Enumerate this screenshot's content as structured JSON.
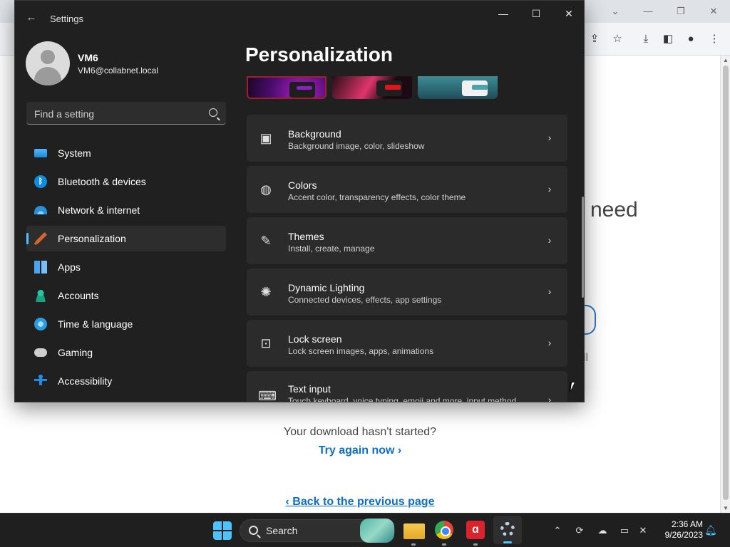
{
  "browser": {
    "content": {
      "heading_fragment": "need",
      "fragment_ll": "ll",
      "download_msg": "Your download hasn't started?",
      "try_again": "Try again now ›",
      "back_link": "‹ Back to the previous page"
    }
  },
  "settings": {
    "window_title": "Settings",
    "user": {
      "name": "VM6",
      "email": "VM6@collabnet.local"
    },
    "search_placeholder": "Find a setting",
    "page_title": "Personalization",
    "nav": [
      {
        "label": "System",
        "icon": "system-icon"
      },
      {
        "label": "Bluetooth & devices",
        "icon": "bluetooth-icon"
      },
      {
        "label": "Network & internet",
        "icon": "wifi-icon"
      },
      {
        "label": "Personalization",
        "icon": "brush-icon",
        "active": true
      },
      {
        "label": "Apps",
        "icon": "apps-icon"
      },
      {
        "label": "Accounts",
        "icon": "person-icon"
      },
      {
        "label": "Time & language",
        "icon": "globe-clock-icon"
      },
      {
        "label": "Gaming",
        "icon": "gamepad-icon"
      },
      {
        "label": "Accessibility",
        "icon": "accessibility-icon"
      }
    ],
    "cards": [
      {
        "title": "Background",
        "subtitle": "Background image, color, slideshow",
        "icon": "image-icon"
      },
      {
        "title": "Colors",
        "subtitle": "Accent color, transparency effects, color theme",
        "icon": "palette-icon"
      },
      {
        "title": "Themes",
        "subtitle": "Install, create, manage",
        "icon": "brush-icon"
      },
      {
        "title": "Dynamic Lighting",
        "subtitle": "Connected devices, effects, app settings",
        "icon": "light-icon"
      },
      {
        "title": "Lock screen",
        "subtitle": "Lock screen images, apps, animations",
        "icon": "lock-screen-icon"
      },
      {
        "title": "Text input",
        "subtitle": "Touch keyboard, voice typing, emoji and more, input method",
        "icon": "keyboard-icon"
      }
    ],
    "theme_thumbs": [
      {
        "name": "dark-purple",
        "accent": "#8e1dc5"
      },
      {
        "name": "dark-red",
        "accent": "#e0141b"
      },
      {
        "name": "teal",
        "accent": "#4aa3ad"
      }
    ]
  },
  "taskbar": {
    "search_label": "Search",
    "time": "2:36 AM",
    "date": "9/26/2023"
  },
  "colors": {
    "accent": "#4cc2ff",
    "link": "#0b6ec7",
    "settings_bg": "#202020",
    "card_bg": "#2b2b2b"
  }
}
